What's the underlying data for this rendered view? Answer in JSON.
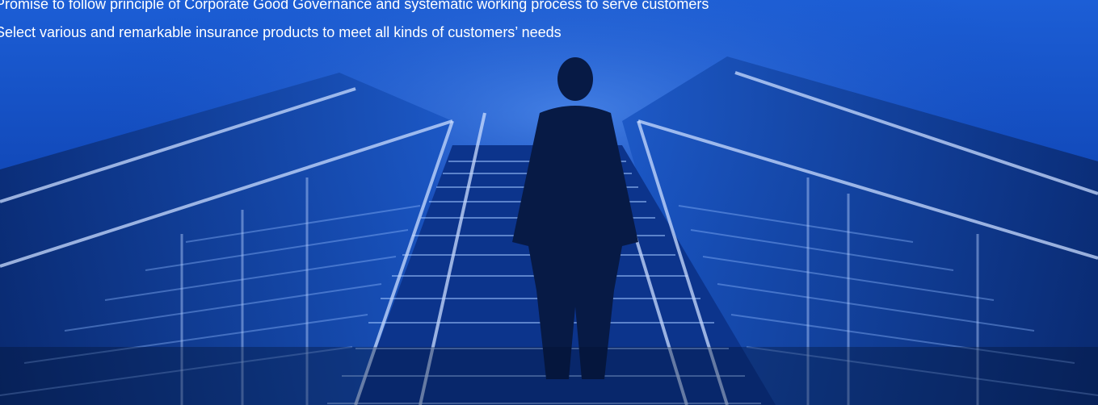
{
  "hero": {
    "lines": [
      "Promise to follow principle of Corporate Good Governance and systematic working process to serve customers",
      "Select various and remarkable insurance products to meet all kinds of customers’ needs"
    ],
    "image_subject": "businessman-climbing-stairs-photo",
    "colors": {
      "tint": "#0b3fa8",
      "text": "#ffffff"
    }
  }
}
